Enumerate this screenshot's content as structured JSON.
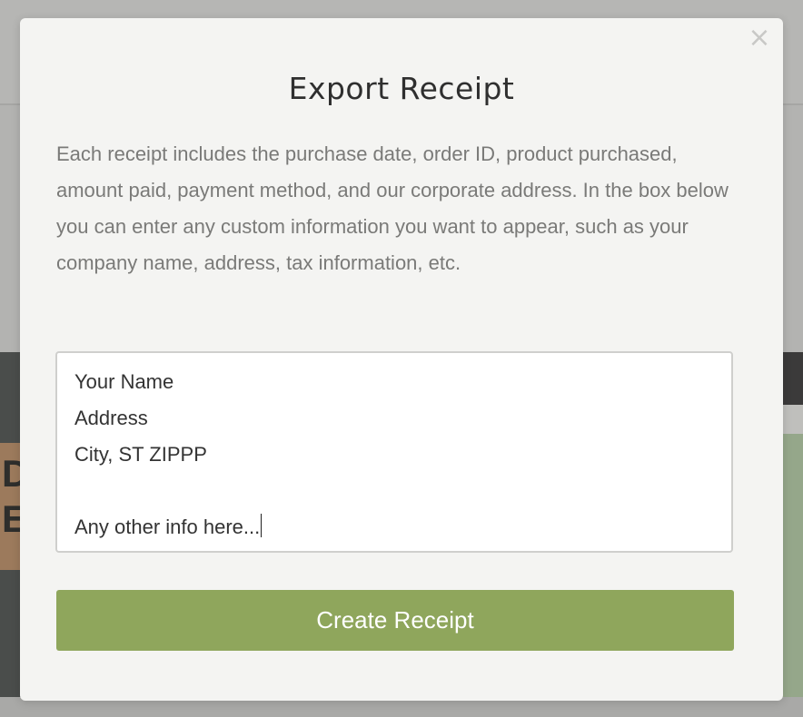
{
  "modal": {
    "title": "Export Receipt",
    "close_icon": "close-icon",
    "description": "Each receipt includes the purchase date, order ID, product purchased, amount paid, payment method, and our corporate address. In the box below you can enter any custom information you want to appear, such as your company name, address, tax information, etc.",
    "textarea": {
      "lines": [
        "Your Name",
        "Address",
        "City, ST ZIPPP",
        "",
        "Any other info here..."
      ]
    },
    "create_button_label": "Create Receipt"
  },
  "background": {
    "left_letters": [
      "D",
      "E"
    ]
  },
  "colors": {
    "button": "#8fa65c",
    "modal_bg": "#f4f4f2",
    "overlay": "#b3b3b1"
  }
}
